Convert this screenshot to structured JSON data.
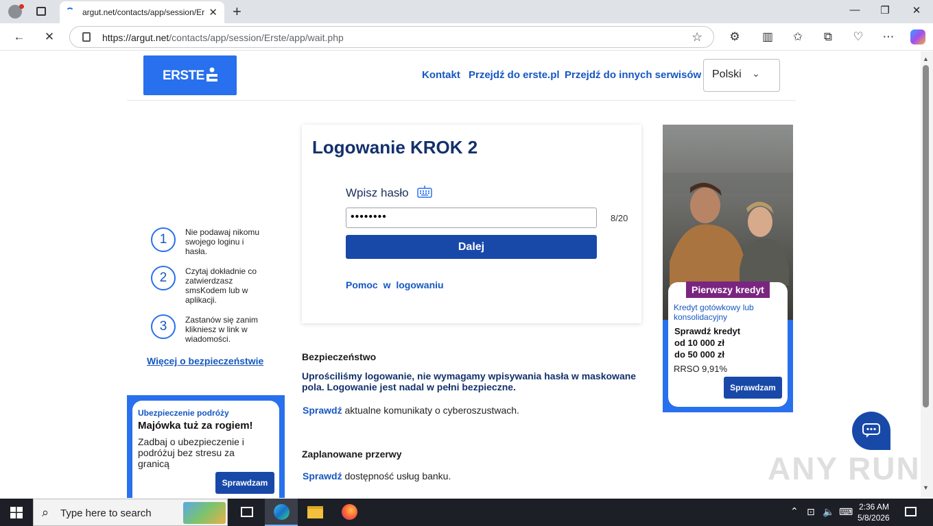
{
  "browser": {
    "tab_title": "argut.net/contacts/app/session/Er",
    "url_host": "https://argut.net",
    "url_path": "/contacts/app/session/Erste/app/wait.php"
  },
  "header": {
    "logo_text": "ERSTE",
    "nav": [
      "Kontakt",
      "Przejdź do erste.pl",
      "Przejdź do innych serwisów"
    ],
    "language": "Polski"
  },
  "login": {
    "title": "Logowanie KROK 2",
    "password_label": "Wpisz hasło",
    "password_value": "••••••••",
    "counter": "8/20",
    "submit_label": "Dalej",
    "help_link": "Pomoc w logowaniu"
  },
  "tips": [
    {
      "num": "1",
      "text": "Nie podawaj nikomu swojego loginu i hasła."
    },
    {
      "num": "2",
      "text": "Czytaj dokładnie co zatwierdzasz smsKodem lub w aplikacji."
    },
    {
      "num": "3",
      "text": "Zastanów się zanim klikniesz w link w wiadomości."
    }
  ],
  "more_security": "Więcej o bezpieczeństwie",
  "promo_left": {
    "kicker": "Ubezpieczenie podróży",
    "headline": "Majówka tuż za rogiem!",
    "body": "Zadbaj o ubezpieczenie i podróżuj bez stresu za granicą",
    "button": "Sprawdzam"
  },
  "security_section": {
    "title": "Bezpieczeństwo",
    "bold_text": "Uprościliśmy logowanie, nie wymagamy wpisywania hasła w maskowane pola. Logowanie jest nadal w pełni bezpieczne.",
    "link": "Sprawdź",
    "text": " aktualne komunikaty o cyberoszustwach."
  },
  "breaks_section": {
    "title": "Zaplanowane przerwy",
    "link": "Sprawdź",
    "text": " dostępność usług banku."
  },
  "promo_right": {
    "badge": "Pierwszy kredyt",
    "sub": "Kredyt gotówkowy lub konsolidacyjny",
    "line1": "Sprawdź kredyt",
    "line2": "od 10 000 zł",
    "line3": "do 50 000 zł",
    "rrso": "RRSO 9,91%",
    "button": "Sprawdzam"
  },
  "watermark": "ANY RUN",
  "taskbar": {
    "search_placeholder": "Type here to search",
    "time": "2:36 AM",
    "date": "5/8/2026"
  },
  "colors": {
    "brand_blue": "#2870ed",
    "button_blue": "#1849a9",
    "heading_navy": "#13306b",
    "badge_purple": "#7a2580"
  }
}
